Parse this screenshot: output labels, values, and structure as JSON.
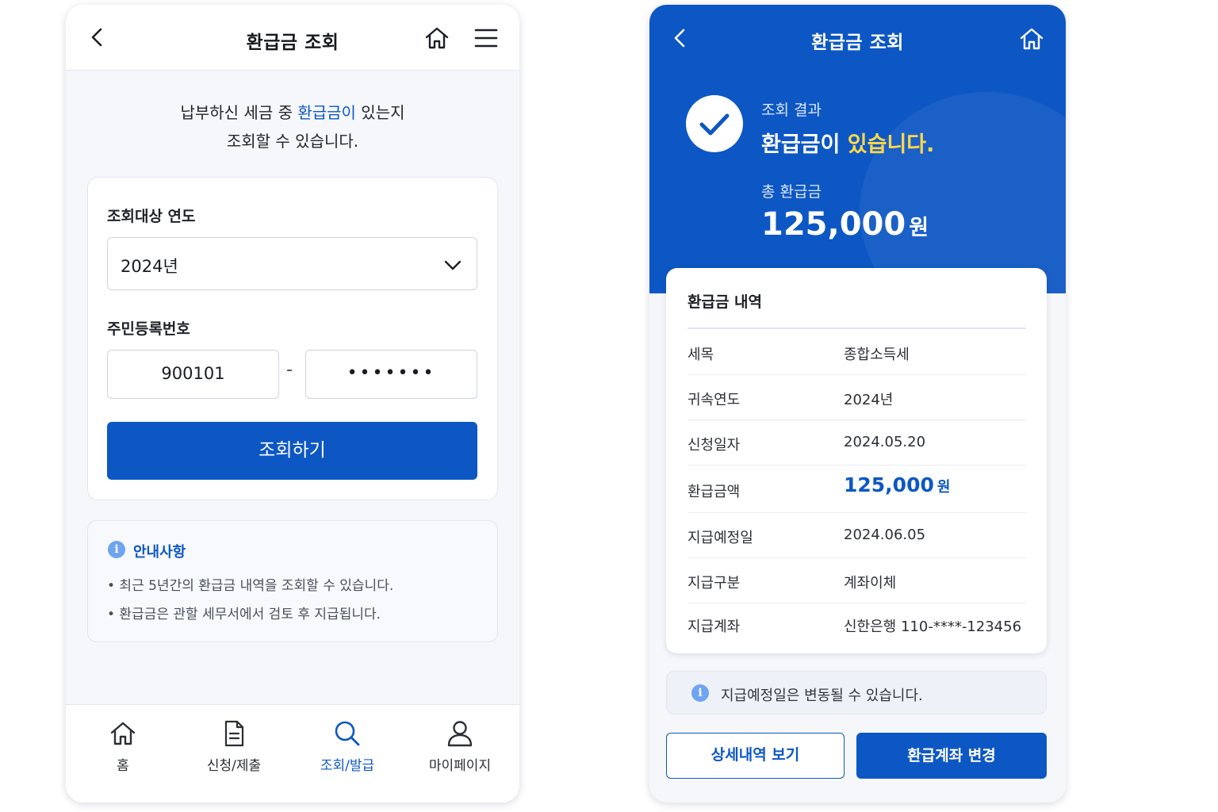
{
  "colors": {
    "primary": "#0d57c4",
    "highlight": "#ffd84a",
    "info": "#6fa4f0",
    "background": "#f5f7fb"
  },
  "left": {
    "header": {
      "title": "환급금 조회",
      "back_icon": "chevron-left-icon",
      "home_icon": "home-icon",
      "menu_icon": "hamburger-menu-icon"
    },
    "intro": {
      "line1_prefix": "납부하신 세금 중 ",
      "line1_accent": "환급금이",
      "line1_suffix": " 있는지",
      "line2": "조회할 수 있습니다."
    },
    "form": {
      "year_label": "조회대상 연도",
      "year_value": "2024년",
      "id_label": "주민등록번호",
      "id_front": "900101",
      "id_separator": "-",
      "id_back_masked": "•••••••",
      "submit_label": "조회하기"
    },
    "notice": {
      "title": "안내사항",
      "items": [
        "• 최근 5년간의 환급금 내역을 조회할 수 있습니다.",
        "• 환급금은 관할 세무서에서 검토 후 지급됩니다."
      ]
    },
    "nav": [
      {
        "label": "홈",
        "icon": "home-icon",
        "active": false
      },
      {
        "label": "신청/제출",
        "icon": "document-icon",
        "active": false
      },
      {
        "label": "조회/발급",
        "icon": "search-icon",
        "active": true
      },
      {
        "label": "마이페이지",
        "icon": "user-icon",
        "active": false
      }
    ]
  },
  "right": {
    "header": {
      "title": "환급금 조회",
      "back_icon": "chevron-left-icon",
      "home_icon": "home-icon"
    },
    "result": {
      "label": "조회 결과",
      "main_prefix": "환급금이 ",
      "main_highlight": "있습니다.",
      "total_label": "총 환급금",
      "total_amount": "125,000",
      "total_unit": "원",
      "icon": "check-icon"
    },
    "details": {
      "title": "환급금 내역",
      "rows": [
        {
          "key": "세목",
          "value": "종합소득세"
        },
        {
          "key": "귀속연도",
          "value": "2024년"
        },
        {
          "key": "신청일자",
          "value": "2024.05.20"
        },
        {
          "key": "환급금액",
          "value": "125,000",
          "unit": "원"
        },
        {
          "key": "지급예정일",
          "value": "2024.06.05"
        },
        {
          "key": "지급구분",
          "value": "계좌이체"
        },
        {
          "key": "지급계좌",
          "value": "신한은행 110-****-123456"
        }
      ]
    },
    "notice": "지급예정일은 변동될 수 있습니다.",
    "buttons": {
      "detail": "상세내역 보기",
      "change_account": "환급계좌 변경"
    }
  }
}
